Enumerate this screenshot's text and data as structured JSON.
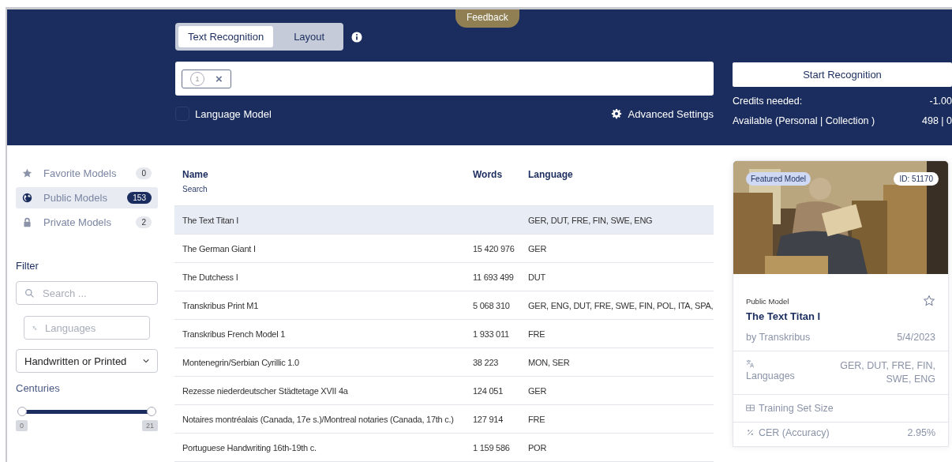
{
  "feedback": "Feedback",
  "tabs": [
    {
      "label": "Text Recognition",
      "selected": true
    },
    {
      "label": "Layout",
      "selected": false
    }
  ],
  "model_chip": {
    "number": "1",
    "remove": "×"
  },
  "language_model": {
    "label": "Language Model",
    "checked": false
  },
  "advanced_settings": "Advanced Settings",
  "start_button": "Start Recognition",
  "credits": [
    {
      "label": "Credits needed:",
      "value": "-1.00"
    },
    {
      "label": "Available (Personal | Collection )",
      "value": "498 | 0"
    }
  ],
  "sidebar": {
    "items": [
      {
        "kind": "star",
        "label": "Favorite Models",
        "count": "0",
        "selected": false
      },
      {
        "kind": "globe",
        "label": "Public Models",
        "count": "153",
        "selected": true
      },
      {
        "kind": "lock",
        "label": "Private Models",
        "count": "2",
        "selected": false
      }
    ],
    "filter_title": "Filter",
    "search": {
      "placeholder": "Search ..."
    },
    "languages": {
      "placeholder": "Languages"
    },
    "type_select": "Handwritten or Printed",
    "centuries": {
      "title": "Centuries",
      "level": 1,
      "min_label": "0",
      "max_label": "21"
    }
  },
  "table": {
    "columns": [
      "Name",
      "Words",
      "Language"
    ],
    "name_search": "Search",
    "rows": [
      {
        "name": "The Text Titan I",
        "words": "",
        "language": "GER, DUT, FRE, FIN, SWE, ENG",
        "selected": true
      },
      {
        "name": "The German Giant I",
        "words": "15 420 976",
        "language": "GER",
        "selected": false
      },
      {
        "name": "The Dutchess I",
        "words": "11 693 499",
        "language": "DUT",
        "selected": false
      },
      {
        "name": "Transkribus Print M1",
        "words": "5 068 310",
        "language": "GER, ENG, DUT, FRE, SWE, FIN, POL, ITA, SPA,",
        "selected": false
      },
      {
        "name": "Transkribus French Model 1",
        "words": "1 933 011",
        "language": "FRE",
        "selected": false
      },
      {
        "name": "Montenegrin/Serbian Cyrillic 1.0",
        "words": "38 223",
        "language": "MON, SER",
        "selected": false
      },
      {
        "name": "Rezesse niederdeutscher Städtetage XVII 4a",
        "words": "124 051",
        "language": "GER",
        "selected": false
      },
      {
        "name": "Notaires montréalais (Canada, 17e s.)/Montreal notaries (Canada, 17th c.)",
        "words": "127 914",
        "language": "FRE",
        "selected": false
      },
      {
        "name": "Portuguese Handwriting 16th-19th c.",
        "words": "1 159 586",
        "language": "POR",
        "selected": false
      }
    ]
  },
  "card": {
    "badge": "Featured Model",
    "id": "ID: 51170",
    "type": "Public Model",
    "favorite": false,
    "title": "The Text Titan I",
    "author": "by Transkribus",
    "date": "5/4/2023",
    "languages_label": "Languages",
    "languages_value": "GER, DUT, FRE, FIN, SWE, ENG",
    "training_label": "Training Set Size",
    "cer_label": "CER (Accuracy)",
    "cer_value": "2.95%"
  }
}
